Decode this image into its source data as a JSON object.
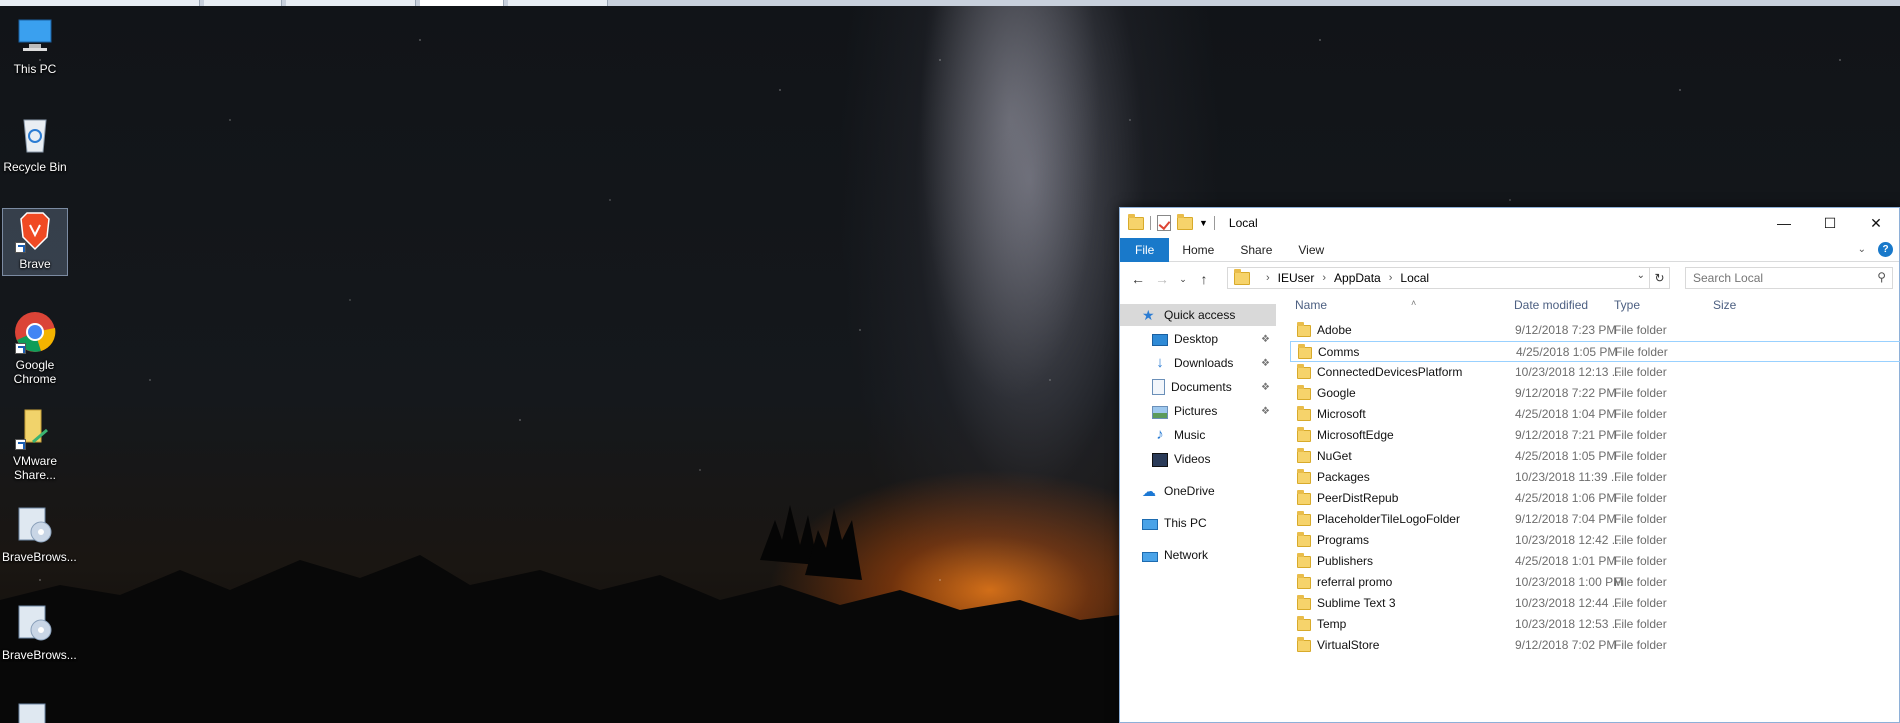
{
  "desktop": {
    "icons": [
      {
        "label": "This PC",
        "icon": "this-pc-icon"
      },
      {
        "label": "Recycle Bin",
        "icon": "recycle-bin-icon"
      },
      {
        "label": "Brave",
        "icon": "brave-icon",
        "selected": true
      },
      {
        "label": "Google Chrome",
        "icon": "chrome-icon"
      },
      {
        "label": "VMware Share...",
        "icon": "vmware-shared-folder-icon"
      },
      {
        "label": "BraveBrows...",
        "icon": "installer-icon"
      },
      {
        "label": "BraveBrows...",
        "icon": "installer-icon"
      }
    ]
  },
  "explorer": {
    "title": "Local",
    "tabs": {
      "file": "File",
      "home": "Home",
      "share": "Share",
      "view": "View"
    },
    "help": "?",
    "address": {
      "crumbs": [
        "IEUser",
        "AppData",
        "Local"
      ]
    },
    "search": {
      "placeholder": "Search Local"
    },
    "nav": {
      "quick_access": "Quick access",
      "desktop": "Desktop",
      "downloads": "Downloads",
      "documents": "Documents",
      "pictures": "Pictures",
      "music": "Music",
      "videos": "Videos",
      "onedrive": "OneDrive",
      "this_pc": "This PC",
      "network": "Network"
    },
    "columns": {
      "name": "Name",
      "date": "Date modified",
      "type": "Type",
      "size": "Size"
    },
    "files": [
      {
        "name": "Adobe",
        "date": "9/12/2018 7:23 PM",
        "type": "File folder"
      },
      {
        "name": "Comms",
        "date": "4/25/2018 1:05 PM",
        "type": "File folder"
      },
      {
        "name": "ConnectedDevicesPlatform",
        "date": "10/23/2018 12:13 ...",
        "type": "File folder"
      },
      {
        "name": "Google",
        "date": "9/12/2018 7:22 PM",
        "type": "File folder"
      },
      {
        "name": "Microsoft",
        "date": "4/25/2018 1:04 PM",
        "type": "File folder"
      },
      {
        "name": "MicrosoftEdge",
        "date": "9/12/2018 7:21 PM",
        "type": "File folder"
      },
      {
        "name": "NuGet",
        "date": "4/25/2018 1:05 PM",
        "type": "File folder"
      },
      {
        "name": "Packages",
        "date": "10/23/2018 11:39 ...",
        "type": "File folder"
      },
      {
        "name": "PeerDistRepub",
        "date": "4/25/2018 1:06 PM",
        "type": "File folder"
      },
      {
        "name": "PlaceholderTileLogoFolder",
        "date": "9/12/2018 7:04 PM",
        "type": "File folder"
      },
      {
        "name": "Programs",
        "date": "10/23/2018 12:42 ...",
        "type": "File folder"
      },
      {
        "name": "Publishers",
        "date": "4/25/2018 1:01 PM",
        "type": "File folder"
      },
      {
        "name": "referral promo",
        "date": "10/23/2018 1:00 PM",
        "type": "File folder"
      },
      {
        "name": "Sublime Text 3",
        "date": "10/23/2018 12:44 ...",
        "type": "File folder"
      },
      {
        "name": "Temp",
        "date": "10/23/2018 12:53 ...",
        "type": "File folder"
      },
      {
        "name": "VirtualStore",
        "date": "9/12/2018 7:02 PM",
        "type": "File folder"
      }
    ],
    "focused_row": "Comms"
  }
}
